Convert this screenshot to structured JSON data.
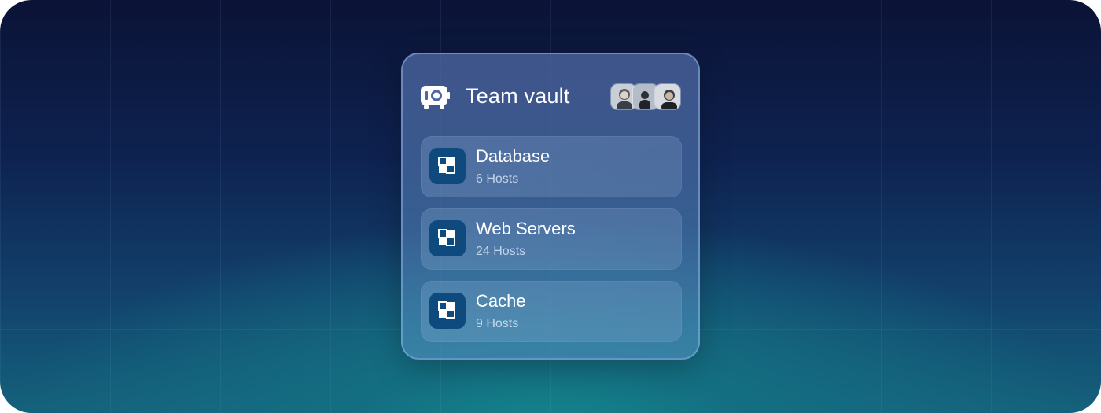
{
  "vault": {
    "title": "Team vault",
    "icon": "vault-icon",
    "members": [
      "member-1",
      "member-2",
      "member-3"
    ]
  },
  "groups": [
    {
      "name": "Database",
      "hosts": "6 Hosts",
      "icon": "group-icon"
    },
    {
      "name": "Web Servers",
      "hosts": "24 Hosts",
      "icon": "group-icon"
    },
    {
      "name": "Cache",
      "hosts": "9 Hosts",
      "icon": "group-icon"
    }
  ],
  "colors": {
    "background_top": "#0b1336",
    "background_glow": "#158a8e",
    "icon_tile": "#0e4a7d",
    "text": "#ffffff"
  }
}
